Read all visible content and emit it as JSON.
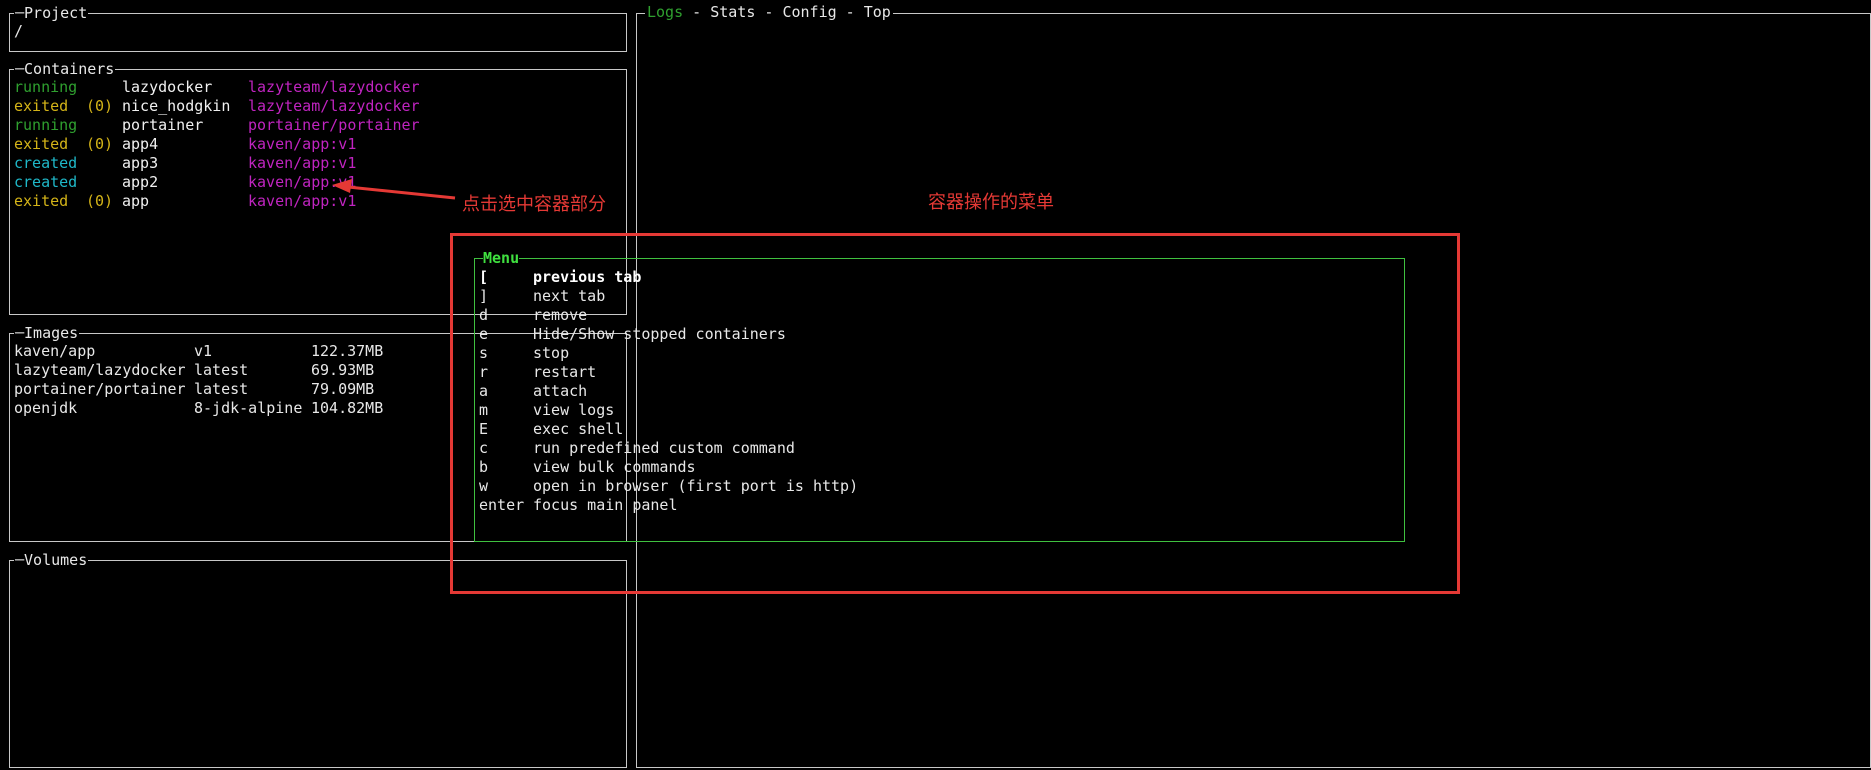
{
  "project": {
    "title": "Project",
    "path": "/"
  },
  "containers": {
    "title": "Containers",
    "rows": [
      {
        "status": "running",
        "status_color": "#2fa02f",
        "exit_code": "",
        "name": "lazydocker",
        "image": "lazyteam/lazydocker"
      },
      {
        "status": "exited",
        "status_color": "#d4b418",
        "exit_code": "(0)",
        "name": "nice_hodgkin",
        "image": "lazyteam/lazydocker"
      },
      {
        "status": "running",
        "status_color": "#2fa02f",
        "exit_code": "",
        "name": "portainer",
        "image": "portainer/portainer"
      },
      {
        "status": "exited",
        "status_color": "#d4b418",
        "exit_code": "(0)",
        "name": "app4",
        "image": "kaven/app:v1"
      },
      {
        "status": "created",
        "status_color": "#1fb8c8",
        "exit_code": "",
        "name": "app3",
        "image": "kaven/app:v1"
      },
      {
        "status": "created",
        "status_color": "#1fb8c8",
        "exit_code": "",
        "name": "app2",
        "image": "kaven/app:v1"
      },
      {
        "status": "exited",
        "status_color": "#d4b418",
        "exit_code": "(0)",
        "name": "app",
        "image": "kaven/app:v1"
      }
    ]
  },
  "images": {
    "title": "Images",
    "rows": [
      {
        "name": "kaven/app",
        "tag": "v1",
        "size": "122.37MB"
      },
      {
        "name": "lazyteam/lazydocker",
        "tag": "latest",
        "size": "69.93MB"
      },
      {
        "name": "portainer/portainer",
        "tag": "latest",
        "size": "79.09MB"
      },
      {
        "name": "openjdk",
        "tag": "8-jdk-alpine",
        "size": "104.82MB"
      }
    ]
  },
  "volumes": {
    "title": "Volumes"
  },
  "main": {
    "tabs": [
      {
        "label": "Logs",
        "active": true
      },
      {
        "label": "Stats",
        "active": false
      },
      {
        "label": "Config",
        "active": false
      },
      {
        "label": "Top",
        "active": false
      }
    ],
    "tab_separator": " - "
  },
  "menu": {
    "title": "Menu",
    "items": [
      {
        "key": "[",
        "label": "previous tab",
        "selected": true
      },
      {
        "key": "]",
        "label": "next tab",
        "selected": false
      },
      {
        "key": "d",
        "label": "remove",
        "selected": false
      },
      {
        "key": "e",
        "label": "Hide/Show stopped containers",
        "selected": false
      },
      {
        "key": "s",
        "label": "stop",
        "selected": false
      },
      {
        "key": "r",
        "label": "restart",
        "selected": false
      },
      {
        "key": "a",
        "label": "attach",
        "selected": false
      },
      {
        "key": "m",
        "label": "view logs",
        "selected": false
      },
      {
        "key": "E",
        "label": "exec shell",
        "selected": false
      },
      {
        "key": "c",
        "label": "run predefined custom command",
        "selected": false
      },
      {
        "key": "b",
        "label": "view bulk commands",
        "selected": false
      },
      {
        "key": "w",
        "label": "open in browser (first port is http)",
        "selected": false
      },
      {
        "key": "enter",
        "label": "focus main panel",
        "selected": false
      }
    ]
  },
  "annotations": {
    "click_note": "点击选中容器部分",
    "menu_note": "容器操作的菜单",
    "color": "#e53935"
  }
}
